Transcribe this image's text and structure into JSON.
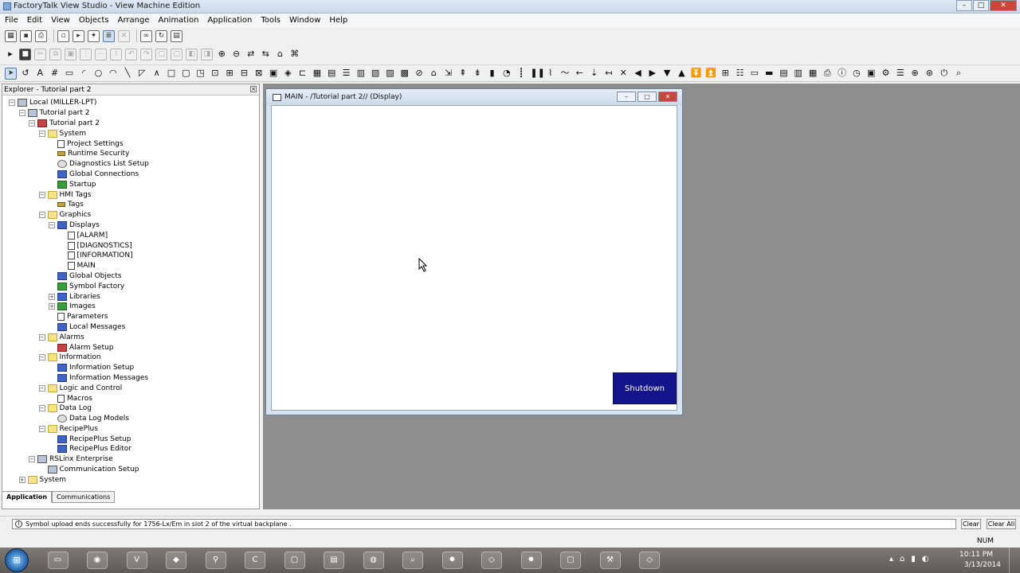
{
  "window": {
    "title": "FactoryTalk View Studio - View Machine Edition",
    "minimize": "–",
    "maximize": "□",
    "close": "✕"
  },
  "menu": [
    "File",
    "Edit",
    "View",
    "Objects",
    "Arrange",
    "Animation",
    "Application",
    "Tools",
    "Window",
    "Help"
  ],
  "explorer": {
    "title": "Explorer - Tutorial part 2",
    "tree": [
      {
        "label": "Local (MILLER-LPT)",
        "level": 0,
        "exp": "−",
        "icon": "computer-icon"
      },
      {
        "label": "Tutorial part 2",
        "level": 1,
        "exp": "−",
        "icon": "application-icon"
      },
      {
        "label": "Tutorial part 2",
        "level": 2,
        "exp": "−",
        "icon": "hmi-server-icon"
      },
      {
        "label": "System",
        "level": 3,
        "exp": "−",
        "icon": "folder-icon"
      },
      {
        "label": "Project Settings",
        "level": 4,
        "exp": "",
        "icon": "settings-icon"
      },
      {
        "label": "Runtime Security",
        "level": 4,
        "exp": "",
        "icon": "key-icon"
      },
      {
        "label": "Diagnostics List Setup",
        "level": 4,
        "exp": "",
        "icon": "clock-icon"
      },
      {
        "label": "Global Connections",
        "level": 4,
        "exp": "",
        "icon": "connections-icon"
      },
      {
        "label": "Startup",
        "level": 4,
        "exp": "",
        "icon": "startup-flag-icon"
      },
      {
        "label": "HMI Tags",
        "level": 3,
        "exp": "−",
        "icon": "folder-icon"
      },
      {
        "label": "Tags",
        "level": 4,
        "exp": "",
        "icon": "tags-icon"
      },
      {
        "label": "Graphics",
        "level": 3,
        "exp": "−",
        "icon": "folder-icon"
      },
      {
        "label": "Displays",
        "level": 4,
        "exp": "−",
        "icon": "displays-icon"
      },
      {
        "label": "[ALARM]",
        "level": 5,
        "exp": "",
        "icon": "document-icon"
      },
      {
        "label": "[DIAGNOSTICS]",
        "level": 5,
        "exp": "",
        "icon": "document-icon"
      },
      {
        "label": "[INFORMATION]",
        "level": 5,
        "exp": "",
        "icon": "document-icon"
      },
      {
        "label": "MAIN",
        "level": 5,
        "exp": "",
        "icon": "document-icon"
      },
      {
        "label": "Global Objects",
        "level": 4,
        "exp": "",
        "icon": "global-objects-icon"
      },
      {
        "label": "Symbol Factory",
        "level": 4,
        "exp": "",
        "icon": "symbol-factory-icon"
      },
      {
        "label": "Libraries",
        "level": 4,
        "exp": "+",
        "icon": "libraries-icon"
      },
      {
        "label": "Images",
        "level": 4,
        "exp": "+",
        "icon": "images-icon"
      },
      {
        "label": "Parameters",
        "level": 4,
        "exp": "",
        "icon": "parameters-icon"
      },
      {
        "label": "Local Messages",
        "level": 4,
        "exp": "",
        "icon": "messages-icon"
      },
      {
        "label": "Alarms",
        "level": 3,
        "exp": "−",
        "icon": "folder-icon"
      },
      {
        "label": "Alarm Setup",
        "level": 4,
        "exp": "",
        "icon": "alarm-icon"
      },
      {
        "label": "Information",
        "level": 3,
        "exp": "−",
        "icon": "folder-icon"
      },
      {
        "label": "Information Setup",
        "level": 4,
        "exp": "",
        "icon": "information-icon"
      },
      {
        "label": "Information Messages",
        "level": 4,
        "exp": "",
        "icon": "messages-icon"
      },
      {
        "label": "Logic and Control",
        "level": 3,
        "exp": "−",
        "icon": "folder-icon"
      },
      {
        "label": "Macros",
        "level": 4,
        "exp": "",
        "icon": "macro-icon"
      },
      {
        "label": "Data Log",
        "level": 3,
        "exp": "−",
        "icon": "folder-icon"
      },
      {
        "label": "Data Log Models",
        "level": 4,
        "exp": "",
        "icon": "data-log-icon"
      },
      {
        "label": "RecipePlus",
        "level": 3,
        "exp": "−",
        "icon": "folder-icon"
      },
      {
        "label": "RecipePlus Setup",
        "level": 4,
        "exp": "",
        "icon": "recipe-icon"
      },
      {
        "label": "RecipePlus Editor",
        "level": 4,
        "exp": "",
        "icon": "recipe-icon"
      },
      {
        "label": "RSLinx Enterprise",
        "level": 2,
        "exp": "−",
        "icon": "rslinx-icon"
      },
      {
        "label": "Communication Setup",
        "level": 3,
        "exp": "",
        "icon": "communication-icon"
      },
      {
        "label": "System",
        "level": 1,
        "exp": "+",
        "icon": "folder-icon"
      }
    ],
    "tabs": [
      "Application",
      "Communications"
    ]
  },
  "display": {
    "title": "MAIN - /Tutorial part 2// (Display)",
    "shutdown_label": "Shutdown"
  },
  "status": {
    "message": "Symbol upload ends successfully for 1756-Lx/Em in slot 2 of the virtual backplane .",
    "clear": "Clear",
    "clear_all": "Clear All",
    "num": "NUM"
  },
  "taskbar": {
    "time": "10:11 PM",
    "date": "3/13/2014",
    "apps": [
      "explorer-icon",
      "chrome-icon",
      "vee-icon",
      "app-icon",
      "logix-icon",
      "cfile-icon",
      "ftview-icon",
      "emulate-icon",
      "eclipse-icon",
      "search-icon",
      "studio-icon",
      "box-icon",
      "studio2-icon",
      "ftview2-icon",
      "tools-icon",
      "box2-icon"
    ]
  },
  "colors": {
    "accent": "#14148a",
    "workspace": "#8e8e8e"
  }
}
